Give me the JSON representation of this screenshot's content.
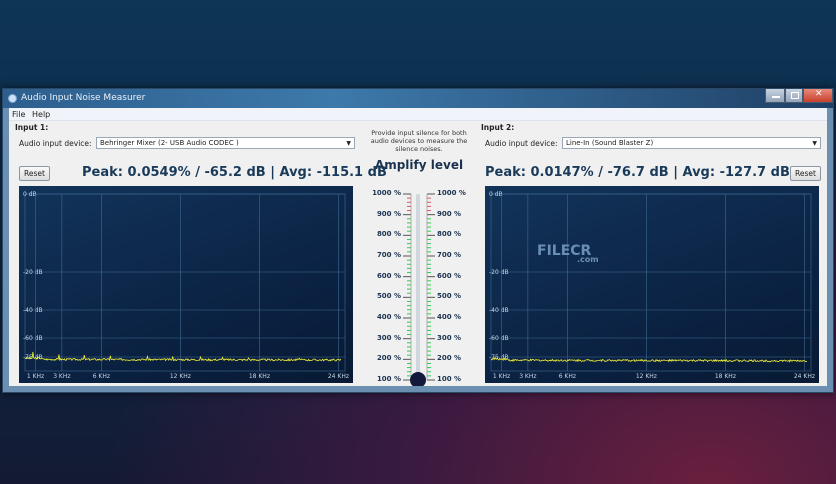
{
  "window": {
    "title": "Audio Input Noise Measurer",
    "controls": [
      "minimize",
      "maximize",
      "close"
    ]
  },
  "menu": [
    "File",
    "Help"
  ],
  "watermark": {
    "text": "FILECR",
    ".com": ".com"
  },
  "input1": {
    "heading": "Input 1:",
    "device_label": "Audio input device:",
    "device_value": "Behringer Mixer (2- USB Audio CODEC )",
    "reset": "Reset",
    "peak_text": "Peak: 0.0549% / -65.2 dB | Avg: -115.1 dB"
  },
  "input2": {
    "heading": "Input 2:",
    "device_label": "Audio input device:",
    "device_value": "Line-In (Sound Blaster Z)",
    "reset": "Reset",
    "peak_text": "Peak: 0.0147% / -76.7 dB | Avg: -127.7 dB"
  },
  "center": {
    "hint": "Provide input silence for both audio devices to measure the silence noises.",
    "amplify_title": "Amplify level",
    "scale": [
      "1000 %",
      "900 %",
      "800 %",
      "700 %",
      "600 %",
      "500 %",
      "400 %",
      "300 %",
      "200 %",
      "100 %"
    ],
    "amplify_value_percent": 100
  },
  "colors": {
    "trace": "#f2f23a",
    "ok": "#2ecc55",
    "warn": "#e0506a"
  },
  "chart_data": [
    {
      "type": "line",
      "title": "Input 1 spectrum",
      "ylabel_ticks": [
        "0 dB",
        "-20 dB",
        "-40 dB",
        "-60 dB",
        "-75 dB"
      ],
      "y_ticks": [
        0,
        -20,
        -40,
        -60,
        -75
      ],
      "xtick_labels": [
        "1 KHz",
        "3 KHz",
        "6 KHz",
        "12 KHz",
        "18 KHz",
        "24 KHz"
      ],
      "x_ticks": [
        1,
        3,
        6,
        12,
        18,
        24
      ],
      "xlim": [
        0.2,
        24.5
      ],
      "noise_floor_db": -77.5,
      "peaks": [
        [
          0.8,
          -71
        ],
        [
          2.8,
          -73
        ],
        [
          4.7,
          -73.5
        ],
        [
          6.7,
          -74
        ],
        [
          9.5,
          -74.5
        ],
        [
          11.4,
          -74.5
        ],
        [
          13.5,
          -75
        ],
        [
          15.2,
          -75.5
        ],
        [
          17.2,
          -76
        ],
        [
          21,
          -76.5
        ]
      ]
    },
    {
      "type": "line",
      "title": "Input 2 spectrum",
      "ylabel_ticks": [
        "0 dB",
        "-20 dB",
        "-40 dB",
        "-60 dB",
        "-75 dB"
      ],
      "y_ticks": [
        0,
        -20,
        -40,
        -60,
        -75
      ],
      "xtick_labels": [
        "1 KHz",
        "3 KHz",
        "6 KHz",
        "12 KHz",
        "18 KHz",
        "24 KHz"
      ],
      "x_ticks": [
        1,
        3,
        6,
        12,
        18,
        24
      ],
      "xlim": [
        0.2,
        24.5
      ],
      "noise_floor_db": -78.5,
      "peaks": [
        [
          0.5,
          -75.5
        ],
        [
          1.2,
          -76.5
        ]
      ]
    }
  ]
}
